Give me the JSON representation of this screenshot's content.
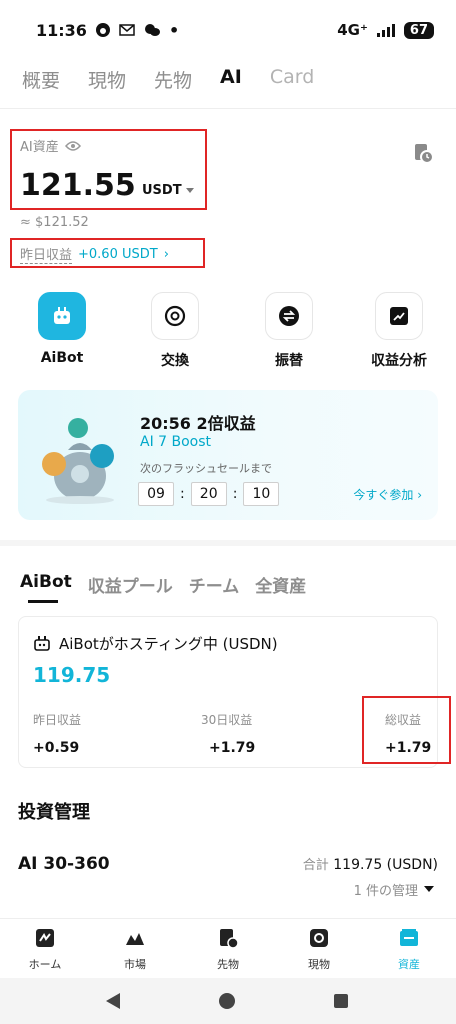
{
  "status_bar": {
    "time": "11:36",
    "network": "4G⁺",
    "battery": "67"
  },
  "top_tabs": [
    "概要",
    "現物",
    "先物",
    "AI",
    "Card"
  ],
  "asset": {
    "label": "AI資産",
    "value": "121.55",
    "unit": "USDT",
    "approx": "≈ $121.52",
    "yesterday_label": "昨日収益",
    "yesterday_value": "+0.60 USDT"
  },
  "actions": [
    {
      "label": "AiBot",
      "icon": "robot-icon"
    },
    {
      "label": "交換",
      "icon": "exchange-icon"
    },
    {
      "label": "振替",
      "icon": "transfer-icon"
    },
    {
      "label": "収益分析",
      "icon": "chart-icon"
    }
  ],
  "promo": {
    "title": "20:56  2倍収益",
    "subtitle": "AI 7 Boost",
    "note": "次のフラッシュセールまで",
    "timer": {
      "h": "09",
      "m": "20",
      "s": "10"
    },
    "join": "今すぐ参加"
  },
  "subtabs": [
    "AiBot",
    "収益プール",
    "チーム",
    "全資産"
  ],
  "bot_card": {
    "title": "AiBotがホスティング中 (USDN)",
    "value": "119.75",
    "stats": [
      {
        "label": "昨日収益",
        "value": "+0.59"
      },
      {
        "label": "30日収益",
        "value": "+1.79"
      },
      {
        "label": "総収益",
        "value": "+1.79"
      }
    ]
  },
  "invest": {
    "title": "投資管理",
    "name": "AI 30-360",
    "total_label": "合計",
    "total_value": "119.75 (USDN)",
    "manage": "1 件の管理"
  },
  "bottom_nav": [
    "ホーム",
    "市場",
    "先物",
    "現物",
    "資産"
  ],
  "colors": {
    "accent": "#12b5d8",
    "highlight_box": "#e02525"
  }
}
